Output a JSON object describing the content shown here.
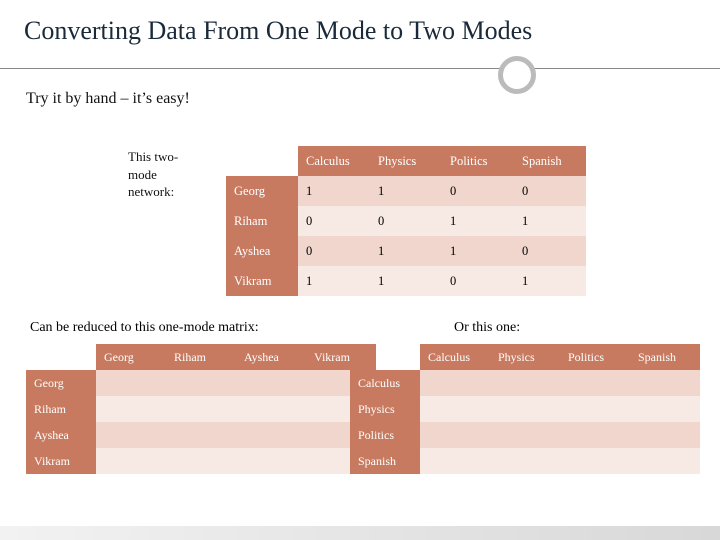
{
  "title": "Converting Data From One Mode to Two Modes",
  "subhead": "Try it by hand – it’s easy!",
  "label_two_mode_1": "This two-",
  "label_two_mode_2": "mode",
  "label_two_mode_3": "network:",
  "cols": [
    "Calculus",
    "Physics",
    "Politics",
    "Spanish"
  ],
  "rows": [
    "Georg",
    "Riham",
    "Ayshea",
    "Vikram"
  ],
  "cells": [
    [
      "1",
      "1",
      "0",
      "0"
    ],
    [
      "0",
      "0",
      "1",
      "1"
    ],
    [
      "0",
      "1",
      "1",
      "0"
    ],
    [
      "1",
      "1",
      "0",
      "1"
    ]
  ],
  "reduce_text": "Can be reduced to this one-mode matrix:",
  "or_text": "Or this one:",
  "mat1_cols": [
    "Georg",
    "Riham",
    "Ayshea",
    "Vikram"
  ],
  "mat1_rows": [
    "Georg",
    "Riham",
    "Ayshea",
    "Vikram"
  ],
  "mat2_cols": [
    "Calculus",
    "Physics",
    "Politics",
    "Spanish"
  ],
  "mat2_rows": [
    "Calculus",
    "Physics",
    "Politics",
    "Spanish"
  ],
  "chart_data": {
    "type": "table",
    "title": "Two-mode network incidence matrix",
    "row_labels": [
      "Georg",
      "Riham",
      "Ayshea",
      "Vikram"
    ],
    "col_labels": [
      "Calculus",
      "Physics",
      "Politics",
      "Spanish"
    ],
    "values": [
      [
        1,
        1,
        0,
        0
      ],
      [
        0,
        0,
        1,
        1
      ],
      [
        0,
        1,
        1,
        0
      ],
      [
        1,
        1,
        0,
        1
      ]
    ]
  }
}
